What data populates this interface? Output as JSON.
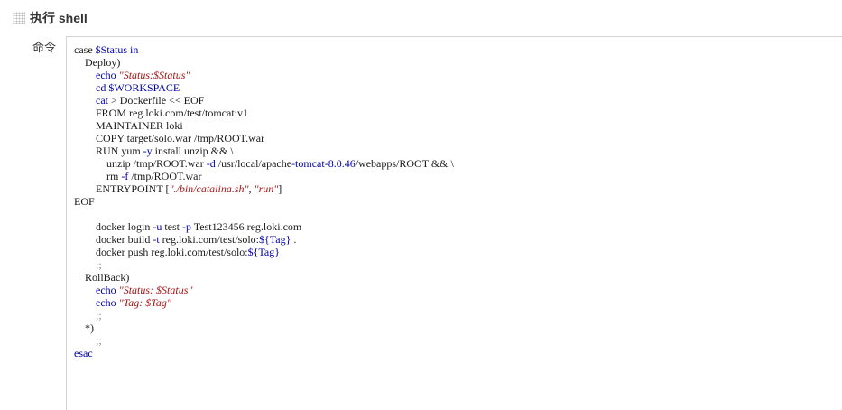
{
  "section": {
    "title": "执行 shell"
  },
  "command_field": {
    "label": "命令",
    "lines": [
      [
        {
          "t": "case ",
          "c": "txt"
        },
        {
          "t": "$Status",
          "c": "var"
        },
        {
          "t": " in",
          "c": "cmd"
        }
      ],
      [
        {
          "t": "    Deploy)",
          "c": "txt"
        }
      ],
      [
        {
          "t": "        ",
          "c": "txt"
        },
        {
          "t": "echo ",
          "c": "cmd"
        },
        {
          "t": "\"Status:$Status\"",
          "c": "str"
        }
      ],
      [
        {
          "t": "        ",
          "c": "txt"
        },
        {
          "t": "cd ",
          "c": "cmd"
        },
        {
          "t": "$WORKSPACE",
          "c": "var"
        }
      ],
      [
        {
          "t": "        ",
          "c": "txt"
        },
        {
          "t": "cat",
          "c": "cmd"
        },
        {
          "t": " > Dockerfile << EOF",
          "c": "txt"
        }
      ],
      [
        {
          "t": "        FROM reg.loki.com/test/tomcat:v1",
          "c": "txt"
        }
      ],
      [
        {
          "t": "        MAINTAINER loki",
          "c": "txt"
        }
      ],
      [
        {
          "t": "        COPY target/solo.war /tmp/ROOT.war",
          "c": "txt"
        }
      ],
      [
        {
          "t": "        RUN yum ",
          "c": "txt"
        },
        {
          "t": "-y",
          "c": "opt"
        },
        {
          "t": " install unzip && \\",
          "c": "txt"
        }
      ],
      [
        {
          "t": "            unzip /tmp/ROOT.war ",
          "c": "txt"
        },
        {
          "t": "-d",
          "c": "opt"
        },
        {
          "t": " /usr/local/apache",
          "c": "txt"
        },
        {
          "t": "-tomcat-8.0.46",
          "c": "opt"
        },
        {
          "t": "/webapps/ROOT && \\",
          "c": "txt"
        }
      ],
      [
        {
          "t": "            rm ",
          "c": "txt"
        },
        {
          "t": "-f",
          "c": "opt"
        },
        {
          "t": " /tmp/ROOT.war",
          "c": "txt"
        }
      ],
      [
        {
          "t": "        ENTRYPOINT [",
          "c": "txt"
        },
        {
          "t": "\"./bin/catalina.sh\"",
          "c": "str"
        },
        {
          "t": ", ",
          "c": "txt"
        },
        {
          "t": "\"run\"",
          "c": "str"
        },
        {
          "t": "]",
          "c": "txt"
        }
      ],
      [
        {
          "t": "EOF",
          "c": "txt"
        }
      ],
      [
        {
          "t": "",
          "c": "txt"
        }
      ],
      [
        {
          "t": "        docker login ",
          "c": "txt"
        },
        {
          "t": "-u",
          "c": "opt"
        },
        {
          "t": " test ",
          "c": "txt"
        },
        {
          "t": "-p",
          "c": "opt"
        },
        {
          "t": " Test123456 reg.loki.com",
          "c": "txt"
        }
      ],
      [
        {
          "t": "        docker build ",
          "c": "txt"
        },
        {
          "t": "-t",
          "c": "opt"
        },
        {
          "t": " reg.loki.com/test/solo:",
          "c": "txt"
        },
        {
          "t": "${Tag}",
          "c": "var"
        },
        {
          "t": " .",
          "c": "txt"
        }
      ],
      [
        {
          "t": "        docker push reg.loki.com/test/solo:",
          "c": "txt"
        },
        {
          "t": "${Tag}",
          "c": "var"
        }
      ],
      [
        {
          "t": "        ;;",
          "c": "dim"
        }
      ],
      [
        {
          "t": "    RollBack)",
          "c": "txt"
        }
      ],
      [
        {
          "t": "        ",
          "c": "txt"
        },
        {
          "t": "echo ",
          "c": "cmd"
        },
        {
          "t": "\"Status: $Status\"",
          "c": "str"
        }
      ],
      [
        {
          "t": "        ",
          "c": "txt"
        },
        {
          "t": "echo ",
          "c": "cmd"
        },
        {
          "t": "\"Tag: $Tag\"",
          "c": "str"
        }
      ],
      [
        {
          "t": "        ;;",
          "c": "dim"
        }
      ],
      [
        {
          "t": "    *)",
          "c": "txt"
        }
      ],
      [
        {
          "t": "        ;;",
          "c": "dim"
        }
      ],
      [
        {
          "t": "esac",
          "c": "cmd"
        }
      ]
    ]
  }
}
